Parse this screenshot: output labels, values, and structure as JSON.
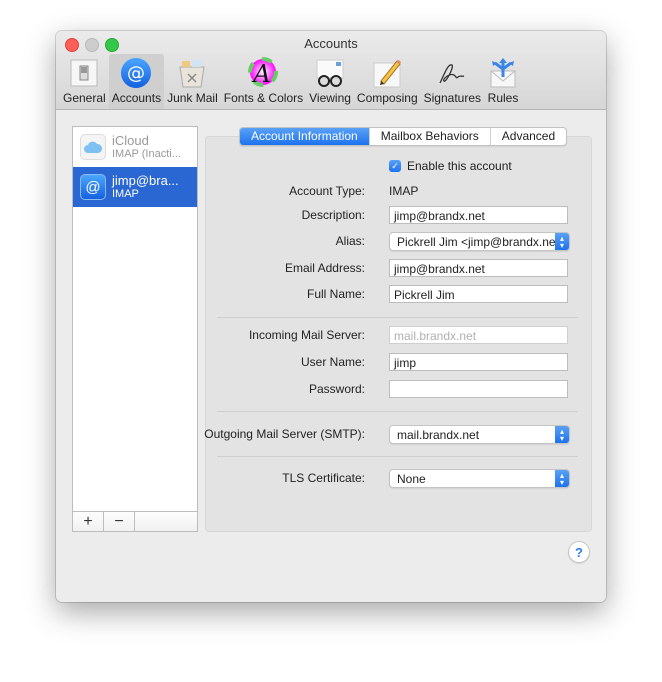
{
  "window": {
    "title": "Accounts"
  },
  "toolbar": {
    "items": [
      {
        "label": "General",
        "icon": "switch-icon"
      },
      {
        "label": "Accounts",
        "icon": "at-sign-icon"
      },
      {
        "label": "Junk Mail",
        "icon": "trash-basket-icon"
      },
      {
        "label": "Fonts & Colors",
        "icon": "font-color-wheel-icon"
      },
      {
        "label": "Viewing",
        "icon": "glasses-icon"
      },
      {
        "label": "Composing",
        "icon": "pencil-icon"
      },
      {
        "label": "Signatures",
        "icon": "signature-icon"
      },
      {
        "label": "Rules",
        "icon": "envelope-arrows-icon"
      }
    ],
    "active": "Accounts"
  },
  "accounts": [
    {
      "name": "iCloud",
      "type": "IMAP (Inacti...",
      "state": "inactive"
    },
    {
      "name": "jimp@bra...",
      "type": "IMAP",
      "state": "selected"
    }
  ],
  "list_buttons": {
    "add": "+",
    "remove": "−"
  },
  "tabs": [
    {
      "label": "Account Information",
      "active": true
    },
    {
      "label": "Mailbox Behaviors",
      "active": false
    },
    {
      "label": "Advanced",
      "active": false
    }
  ],
  "form": {
    "enable_label": "Enable this account",
    "enable_checked": true,
    "account_type_label": "Account Type:",
    "account_type_value": "IMAP",
    "description_label": "Description:",
    "description_value": "jimp@brandx.net",
    "alias_label": "Alias:",
    "alias_value": "Pickrell Jim <jimp@brandx.net>",
    "email_label": "Email Address:",
    "email_value": "jimp@brandx.net",
    "fullname_label": "Full Name:",
    "fullname_value": "Pickrell Jim",
    "incoming_label": "Incoming Mail Server:",
    "incoming_value": "mail.brandx.net",
    "username_label": "User Name:",
    "username_value": "jimp",
    "password_label": "Password:",
    "password_value": "",
    "smtp_label": "Outgoing Mail Server (SMTP):",
    "smtp_value": "mail.brandx.net",
    "tls_label": "TLS Certificate:",
    "tls_value": "None"
  },
  "help": {
    "label": "?"
  },
  "colors": {
    "accent": "#1d73ef",
    "selection": "#2a67d2"
  }
}
